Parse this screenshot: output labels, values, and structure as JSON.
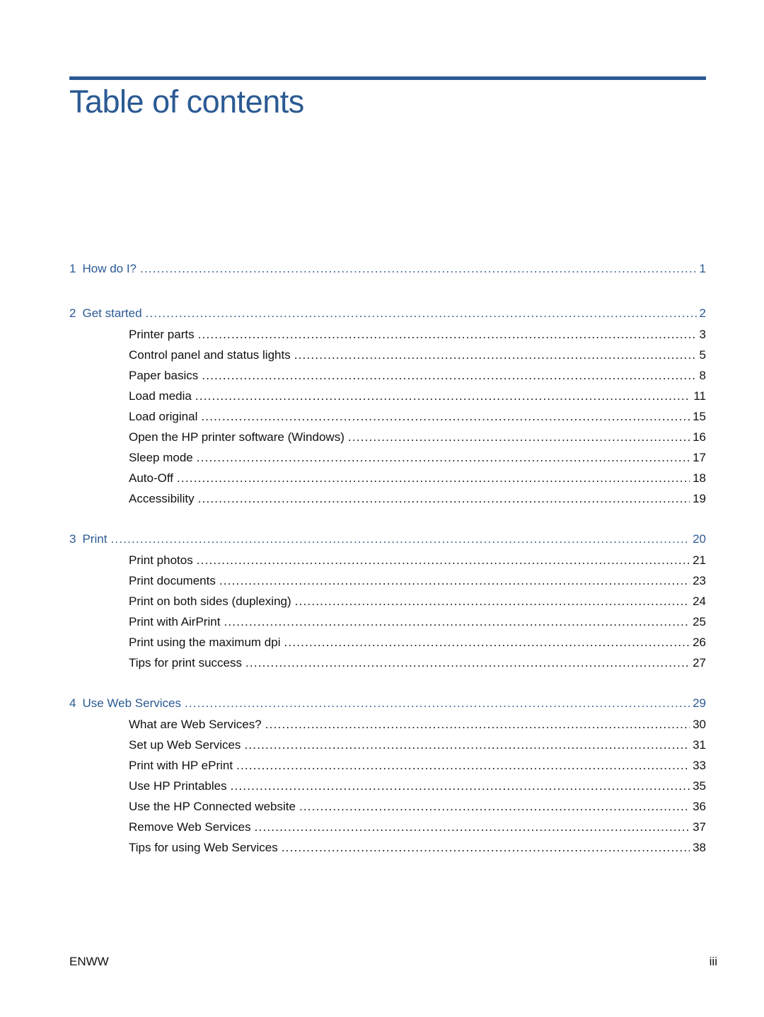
{
  "header": {
    "title": "Table of contents"
  },
  "toc": [
    {
      "number": "1",
      "title": "How do I?",
      "page": "1",
      "sections": []
    },
    {
      "number": "2",
      "title": "Get started",
      "page": "2",
      "sections": [
        {
          "title": "Printer parts",
          "page": "3"
        },
        {
          "title": "Control panel and status lights",
          "page": "5"
        },
        {
          "title": "Paper basics",
          "page": "8"
        },
        {
          "title": "Load media",
          "page": "11"
        },
        {
          "title": "Load original",
          "page": "15"
        },
        {
          "title": "Open the HP printer software (Windows)",
          "page": "16"
        },
        {
          "title": "Sleep mode",
          "page": "17"
        },
        {
          "title": "Auto-Off",
          "page": "18"
        },
        {
          "title": "Accessibility",
          "page": "19"
        }
      ]
    },
    {
      "number": "3",
      "title": "Print",
      "page": "20",
      "sections": [
        {
          "title": "Print photos",
          "page": "21"
        },
        {
          "title": "Print documents",
          "page": "23"
        },
        {
          "title": "Print on both sides (duplexing)",
          "page": "24"
        },
        {
          "title": "Print with AirPrint",
          "page": "25"
        },
        {
          "title": "Print using the maximum dpi",
          "page": "26"
        },
        {
          "title": "Tips for print success",
          "page": "27"
        }
      ]
    },
    {
      "number": "4",
      "title": "Use Web Services",
      "page": "29",
      "sections": [
        {
          "title": "What are Web Services?",
          "page": "30"
        },
        {
          "title": "Set up Web Services",
          "page": "31"
        },
        {
          "title": "Print with HP ePrint",
          "page": "33"
        },
        {
          "title": "Use HP Printables",
          "page": "35"
        },
        {
          "title": "Use the HP Connected website",
          "page": "36"
        },
        {
          "title": "Remove Web Services",
          "page": "37"
        },
        {
          "title": "Tips for using Web Services",
          "page": "38"
        }
      ]
    }
  ],
  "footer": {
    "left": "ENWW",
    "right": "iii"
  },
  "colors": {
    "accent": "#2b5a93",
    "text": "#111111"
  }
}
